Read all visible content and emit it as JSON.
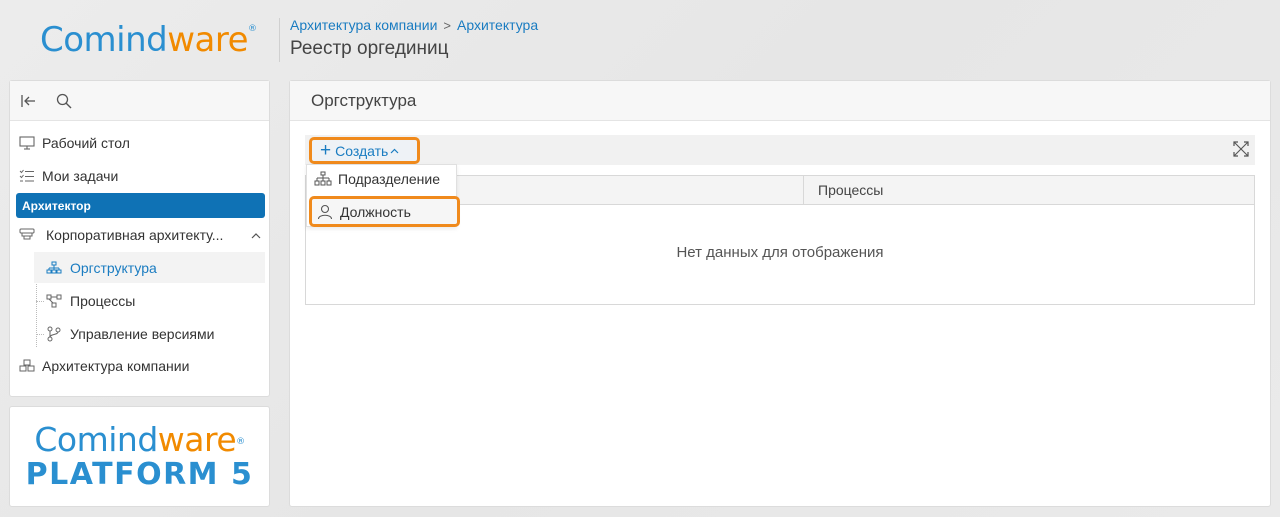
{
  "header": {
    "logo": {
      "part1": "Com",
      "part2": "ind",
      "part3": "ware",
      "reg": "®"
    },
    "breadcrumb": [
      "Архитектура компании",
      "Архитектура"
    ],
    "breadcrumb_separator": ">",
    "page_title": "Реестр оргединиц"
  },
  "sidebar": {
    "items": [
      {
        "label": "Рабочий стол",
        "icon": "monitor-icon"
      },
      {
        "label": "Мои задачи",
        "icon": "tasks-icon"
      },
      {
        "label": "Архитектор"
      },
      {
        "label": "Корпоративная архитекту...",
        "icon": "layers-icon"
      },
      {
        "label": "Оргструктура",
        "icon": "org-chart-icon"
      },
      {
        "label": "Процессы",
        "icon": "process-icon"
      },
      {
        "label": "Управление версиями",
        "icon": "branch-icon"
      },
      {
        "label": "Архитектура компании",
        "icon": "cubes-icon"
      }
    ]
  },
  "brand": {
    "logo": {
      "part1": "Com",
      "part2": "ind",
      "part3": "ware",
      "reg": "®"
    },
    "platform": "PLATFORM 5"
  },
  "main": {
    "title": "Оргструктура",
    "create_label": "Создать",
    "grid": {
      "columns": [
        "",
        "Процессы"
      ],
      "empty_text": "Нет данных для отображения"
    },
    "dropdown": [
      {
        "label": "Подразделение",
        "icon": "org-chart-icon"
      },
      {
        "label": "Должность",
        "icon": "user-icon"
      }
    ]
  },
  "colors": {
    "accent_blue": "#1a7cc1",
    "active_bg": "#0f72b5",
    "highlight_orange": "#f08a1c",
    "logo_orange": "#f18a00",
    "logo_blue": "#2a8fd0"
  }
}
